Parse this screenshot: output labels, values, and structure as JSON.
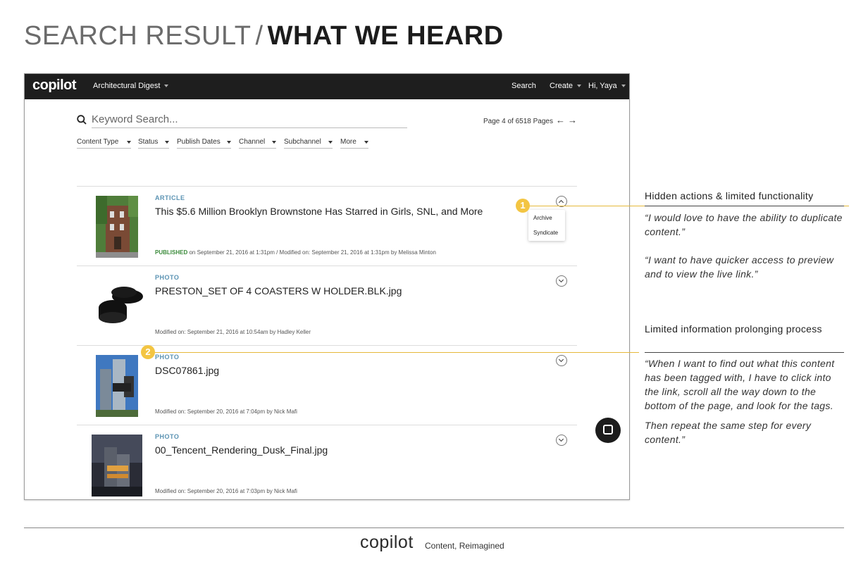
{
  "slide": {
    "title_light": "SEARCH RESULT",
    "title_separator": "/",
    "title_bold": "WHAT WE HEARD"
  },
  "topbar": {
    "logo": "copilot",
    "brand": "Architectural Digest",
    "search": "Search",
    "create": "Create",
    "user": "Hi, Yaya"
  },
  "search": {
    "placeholder": "Keyword Search...",
    "pager_text": "Page 4 of 6518 Pages",
    "prev_arrow": "←",
    "next_arrow": "→"
  },
  "filters": [
    "Content Type",
    "Status",
    "Publish Dates",
    "Channel",
    "Subchannel",
    "More"
  ],
  "results": [
    {
      "type": "ARTICLE",
      "title": "This $5.6 Million Brooklyn Brownstone Has Starred in Girls, SNL, and More",
      "status": "PUBLISHED",
      "meta": "on September 21, 2016 at 1:31pm  /  Modified on: September 21, 2016 at 1:31pm by Melissa Minton",
      "thumb": "brownstone-photo"
    },
    {
      "type": "PHOTO",
      "title": "PRESTON_SET OF 4 COASTERS W HOLDER.BLK.jpg",
      "status": "",
      "meta": "Modified on: September 21, 2016 at 10:54am by Hadley Keller",
      "thumb": "coasters-photo"
    },
    {
      "type": "PHOTO",
      "title": "DSC07861.jpg",
      "status": "",
      "meta": "Modified on: September 20, 2016 at 7:04pm by Nick Mafi",
      "thumb": "tower-photo"
    },
    {
      "type": "PHOTO",
      "title": "00_Tencent_Rendering_Dusk_Final.jpg",
      "status": "",
      "meta": "Modified on: September 20, 2016 at 7:03pm by Nick Mafi",
      "thumb": "tencent-rendering"
    }
  ],
  "dropdown": {
    "archive": "Archive",
    "syndicate": "Syndicate"
  },
  "badges": {
    "one": "1",
    "two": "2"
  },
  "notes": {
    "heading_1": "Hidden actions & limited functionality",
    "quote_1a": "“I would love to have the ability to duplicate content.”",
    "quote_1b": "“I want to have quicker access to preview and to view the live link.”",
    "heading_2": "Limited information prolonging process",
    "quote_2a": "“When I want to find out what this content has been tagged with, I have to click into the link, scroll all the way down to the bottom of the page, and look for the tags.",
    "quote_2b": "Then repeat the same step for every content.”"
  },
  "footer": {
    "logo": "copilot",
    "tagline": "Content, Reimagined"
  },
  "colors": {
    "topbar": "#1e1e1e",
    "type_label": "#5b93b3",
    "published": "#3b8b3b",
    "callout": "#f3c542"
  }
}
